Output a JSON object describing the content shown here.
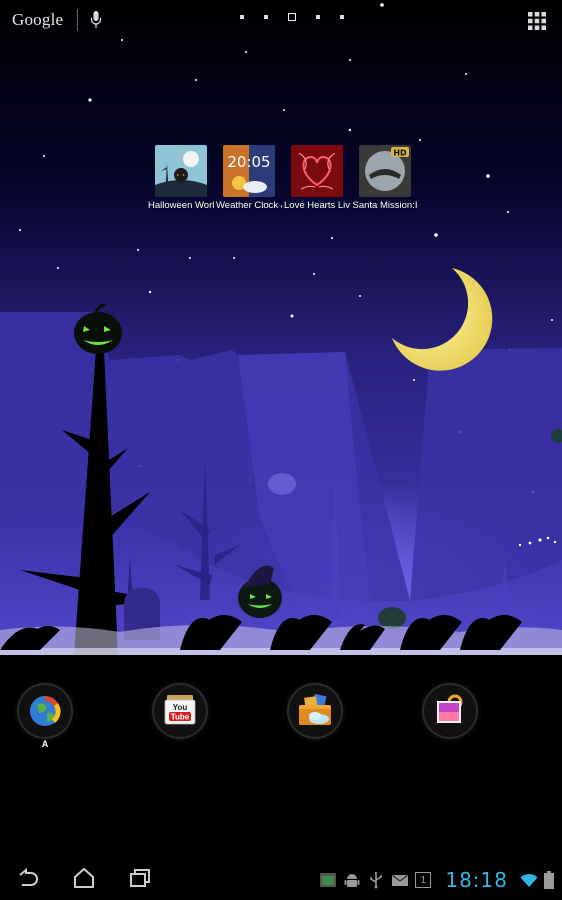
{
  "search_bar": {
    "brand": "Google",
    "mic_icon": "microphone-icon"
  },
  "home_page_dots": 5,
  "apps_button_icon": "app-grid-icon",
  "shortcuts": [
    {
      "label": "Halloween Worl",
      "icon": "halloween-world-thumbnail"
    },
    {
      "label": "Weather Clock &",
      "icon": "weather-clock-thumbnail",
      "clock_text": "20:05"
    },
    {
      "label": "Love Hearts Liv",
      "icon": "love-hearts-thumbnail"
    },
    {
      "label": "Santa Mission:I",
      "icon": "santa-mission-thumbnail",
      "badge": "HD"
    }
  ],
  "dock": [
    {
      "icon": "browser-icon",
      "label": "A"
    },
    {
      "icon": "youtube-icon",
      "label": "",
      "text": "You Tube"
    },
    {
      "icon": "file-manager-icon",
      "label": ""
    },
    {
      "icon": "gallery-icon",
      "label": ""
    }
  ],
  "navbar": {
    "back_icon": "back-icon",
    "home_icon": "home-icon",
    "recents_icon": "recent-apps-icon"
  },
  "status_bar": {
    "clock": "18:18",
    "notification_badge": "1",
    "icons": [
      "screenshot-icon",
      "android-debug-icon",
      "usb-icon",
      "gmail-icon",
      "notification-count-icon",
      "wifi-icon",
      "battery-icon"
    ]
  },
  "colors": {
    "sky_top": "#000000",
    "sky_bottom": "#3a2f9c",
    "clock": "#33b5e5",
    "moon": "#f4e27a",
    "pumpkin_glow": "#5cd24a"
  }
}
